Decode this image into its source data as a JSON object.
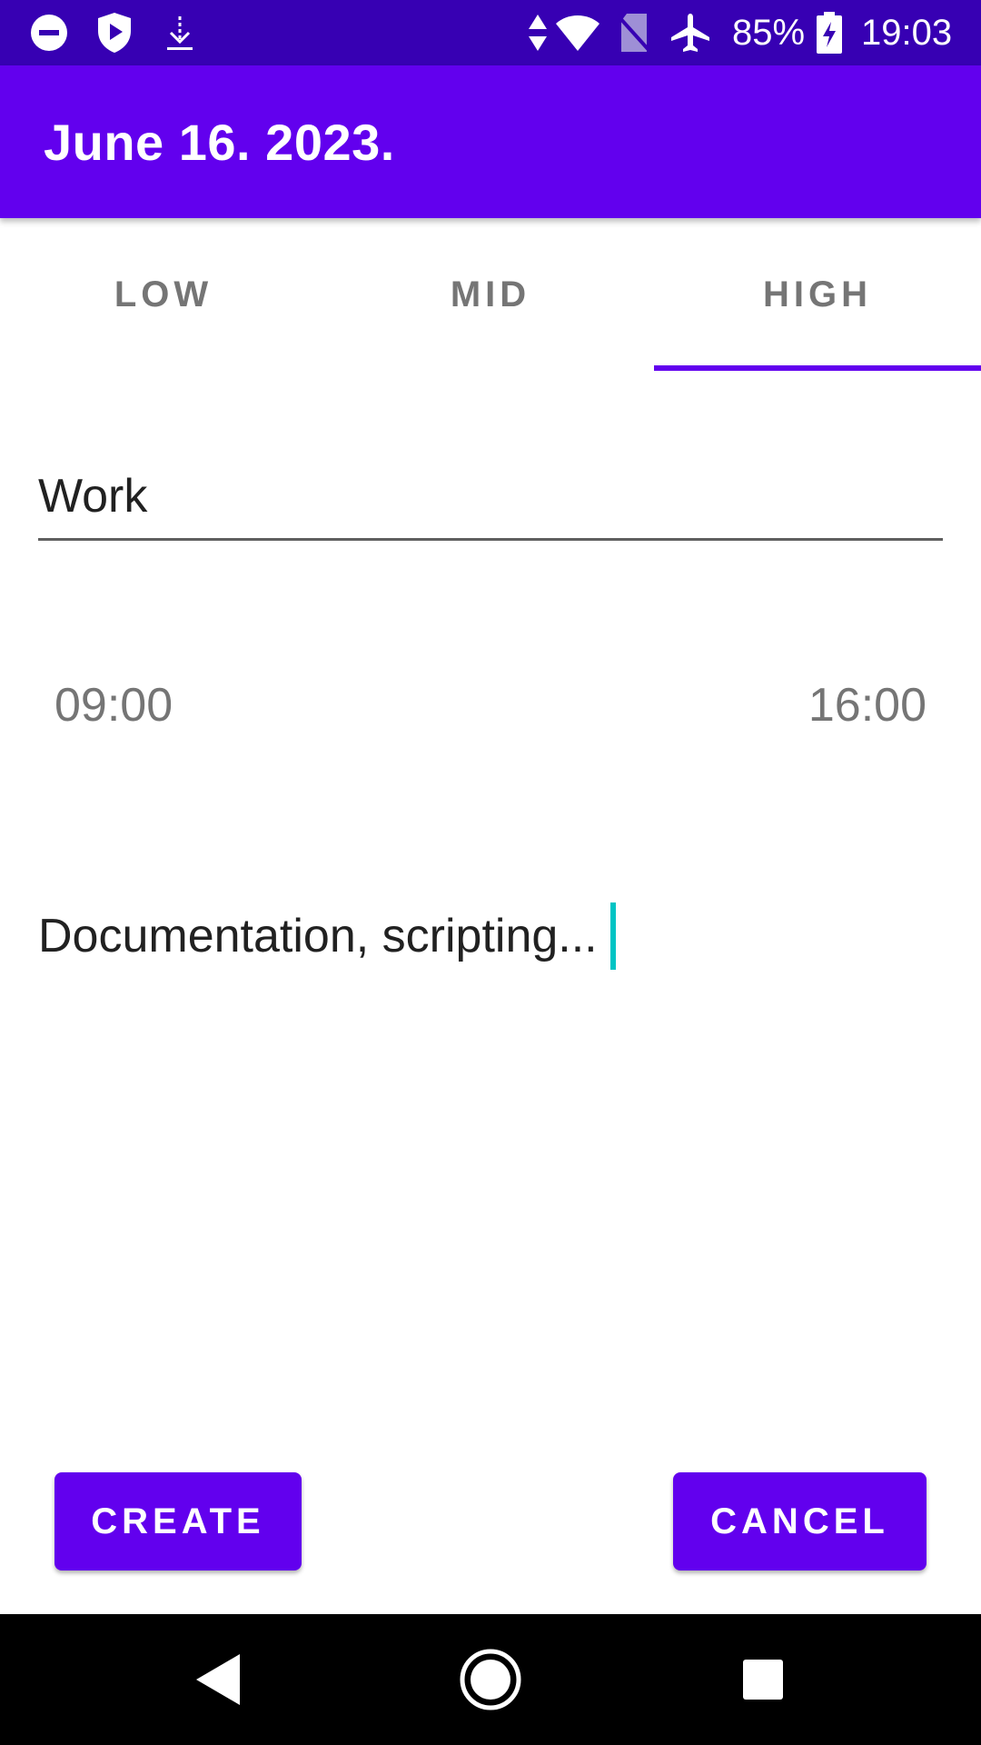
{
  "status_bar": {
    "battery": "85%",
    "time": "19:03",
    "icons": [
      "do-not-disturb-icon",
      "shield-play-icon",
      "download-icon",
      "data-arrows-icon",
      "wifi-icon",
      "no-sim-icon",
      "airplane-icon",
      "battery-charging-icon"
    ]
  },
  "app_bar": {
    "title": "June 16. 2023."
  },
  "tabs": [
    {
      "label": "LOW",
      "selected": false
    },
    {
      "label": "MID",
      "selected": false
    },
    {
      "label": "HIGH",
      "selected": true
    }
  ],
  "form": {
    "title_value": "Work",
    "start_time": "09:00",
    "end_time": "16:00",
    "description_value": "Documentation, scripting..."
  },
  "buttons": {
    "create": "CREATE",
    "cancel": "CANCEL"
  },
  "nav_bar": {
    "icons": [
      "back-icon",
      "home-icon",
      "recents-icon"
    ]
  },
  "colors": {
    "status_bar": "#3700b3",
    "primary": "#6200ee",
    "cursor": "#00c4c4"
  }
}
